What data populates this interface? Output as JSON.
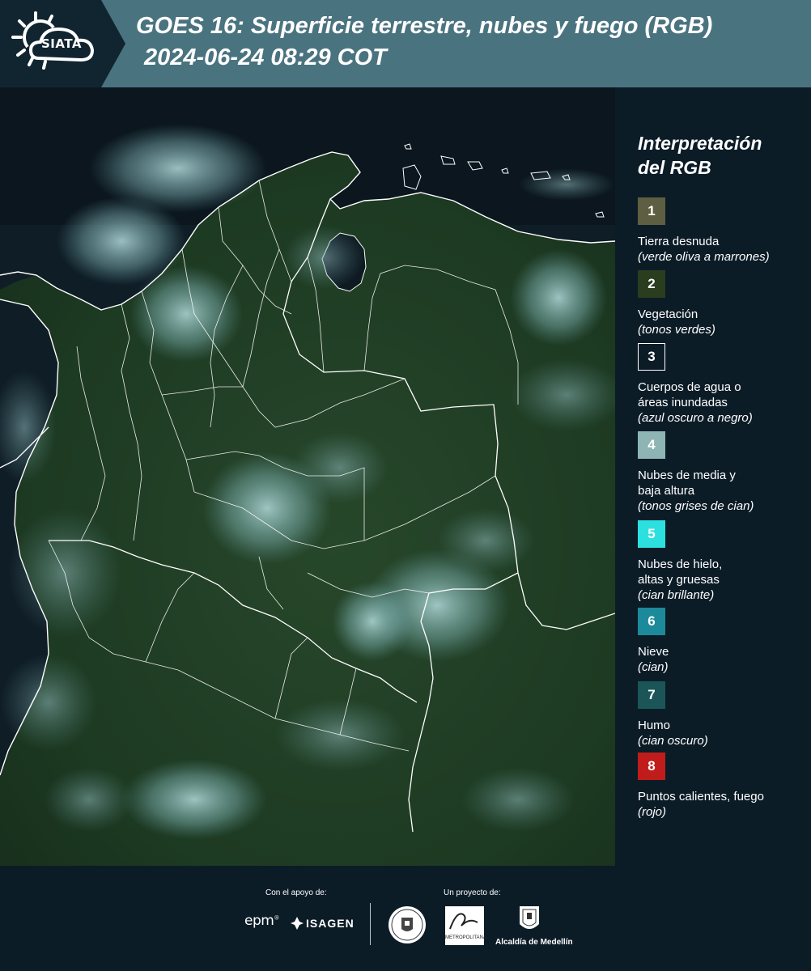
{
  "header": {
    "logo_text": "SIATA",
    "title_line1": "GOES 16: Superficie terrestre, nubes y fuego (RGB)",
    "title_line2": "2024-06-24 08:29 COT"
  },
  "legend": {
    "title_line1": "Interpretación",
    "title_line2": "del RGB",
    "items": [
      {
        "num": "1",
        "label": "Tierra desnuda",
        "desc": "(verde oliva a marrones)",
        "color": "#5e5e42"
      },
      {
        "num": "2",
        "label": "Vegetación",
        "desc": "(tonos verdes)",
        "color": "#2a3d1f"
      },
      {
        "num": "3",
        "label": "Cuerpos de agua o",
        "label2": "áreas inundadas",
        "desc": "(azul oscuro a negro)",
        "color": "#0c1c27",
        "border": "#ffffff"
      },
      {
        "num": "4",
        "label": "Nubes de media y",
        "label2": "baja altura",
        "desc": "(tonos grises de cian)",
        "color": "#8fb4b4"
      },
      {
        "num": "5",
        "label": "Nubes de hielo,",
        "label2": "altas y gruesas",
        "desc": "(cian brillante)",
        "color": "#2de0e0"
      },
      {
        "num": "6",
        "label": "Nieve",
        "desc": "(cian)",
        "color": "#1c8a9a"
      },
      {
        "num": "7",
        "label": "Humo",
        "desc": "(cian oscuro)",
        "color": "#1b5558"
      },
      {
        "num": "8",
        "label": "Puntos calientes, fuego",
        "desc": "(rojo)",
        "color": "#c01c1c"
      }
    ]
  },
  "footer": {
    "support_caption": "Con el apoyo de:",
    "project_caption": "Un proyecto de:",
    "epm": "epm",
    "isagen": "ISAGEN",
    "area_text": "METROPOLITANA",
    "area_script": "Área",
    "medellin": "Alcaldía de Medellín"
  },
  "map": {
    "ocean_color": "#0d1a22",
    "land_color": "#1e3a22",
    "cloud_color": "#9cc7c8",
    "border_color": "#ffffff"
  }
}
